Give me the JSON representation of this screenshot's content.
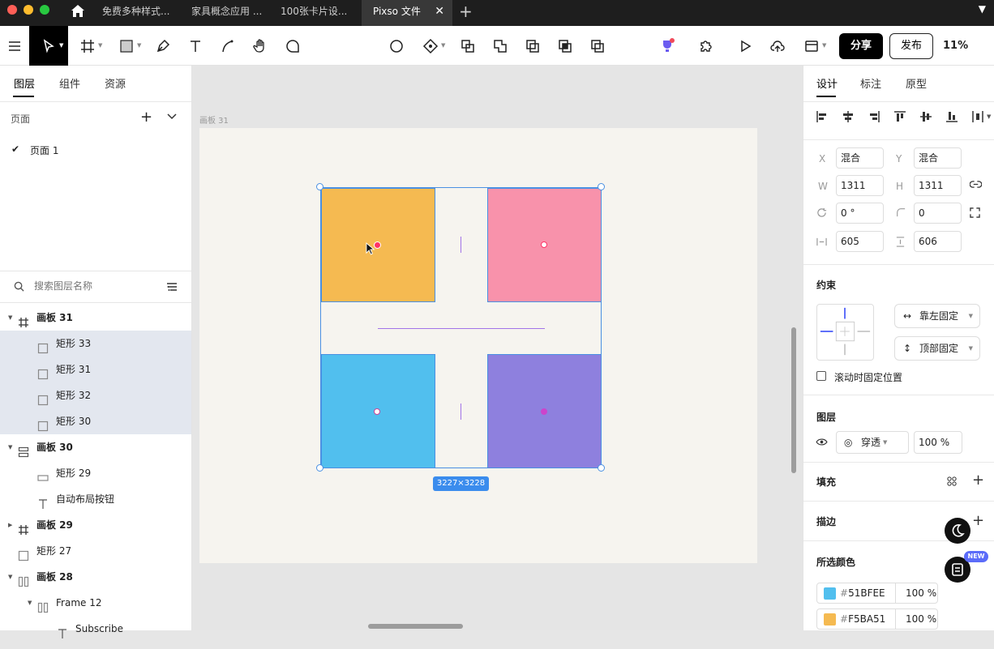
{
  "tabs": [
    {
      "label": "免费多种样式..."
    },
    {
      "label": "家具概念应用 ..."
    },
    {
      "label": "100张卡片设..."
    },
    {
      "label": "Pixso 文件"
    }
  ],
  "toolbar": {
    "share_label": "分享",
    "publish_label": "发布",
    "zoom": "11%"
  },
  "left_panel": {
    "tabs": [
      "图层",
      "组件",
      "资源"
    ],
    "pages_title": "页面",
    "page": "页面 1",
    "search_placeholder": "搜索图层名称",
    "layers": [
      {
        "name": "画板 31",
        "type": "frame",
        "bold": true,
        "indent": 0,
        "expanded": true
      },
      {
        "name": "矩形 33",
        "type": "rect",
        "bold": false,
        "indent": 1,
        "selected": true
      },
      {
        "name": "矩形 31",
        "type": "rect",
        "bold": false,
        "indent": 1,
        "selected": true
      },
      {
        "name": "矩形 32",
        "type": "rect",
        "bold": false,
        "indent": 1,
        "selected": true
      },
      {
        "name": "矩形 30",
        "type": "rect",
        "bold": false,
        "indent": 1,
        "selected": true
      },
      {
        "name": "画板 30",
        "type": "autolayout",
        "bold": true,
        "indent": 0,
        "expanded": true
      },
      {
        "name": "矩形 29",
        "type": "hrect",
        "bold": false,
        "indent": 1
      },
      {
        "name": "自动布局按钮",
        "type": "text",
        "bold": false,
        "indent": 1
      },
      {
        "name": "画板 29",
        "type": "frame",
        "bold": true,
        "indent": 0,
        "expanded": false
      },
      {
        "name": "矩形 27",
        "type": "rect",
        "bold": false,
        "indent": 0
      },
      {
        "name": "画板 28",
        "type": "columns",
        "bold": true,
        "indent": 0,
        "expanded": true
      },
      {
        "name": "Frame 12",
        "type": "columns",
        "bold": false,
        "indent": 1,
        "expanded": true
      },
      {
        "name": "Subscribe",
        "type": "text",
        "bold": false,
        "indent": 2
      }
    ]
  },
  "canvas": {
    "board_label": "画板 31",
    "size_tag": "3227×3228",
    "colors": {
      "orange": "#F5BA51",
      "pink": "#F892AB",
      "blue": "#51BFEE",
      "purple": "#8E80DE"
    }
  },
  "right_panel": {
    "tabs": [
      "设计",
      "标注",
      "原型"
    ],
    "x_label": "X",
    "x_value": "混合",
    "y_label": "Y",
    "y_value": "混合",
    "w_label": "W",
    "w_value": "1311",
    "h_label": "H",
    "h_value": "1311",
    "rotation": "0 °",
    "radius": "0",
    "h_spacing": "605",
    "v_spacing": "606",
    "constraints_title": "约束",
    "constraint_h": "靠左固定",
    "constraint_v": "顶部固定",
    "fix_scroll_label": "滚动时固定位置",
    "layer_title": "图层",
    "blend_mode": "穿透",
    "opacity": "100 %",
    "fill_title": "填充",
    "stroke_title": "描边",
    "selected_colors_title": "所选颜色",
    "selected_colors": [
      {
        "hex": "51BFEE",
        "pct": "100 %",
        "color": "#51BFEE"
      },
      {
        "hex": "F5BA51",
        "pct": "100 %",
        "color": "#F5BA51"
      }
    ],
    "new_badge": "NEW"
  }
}
